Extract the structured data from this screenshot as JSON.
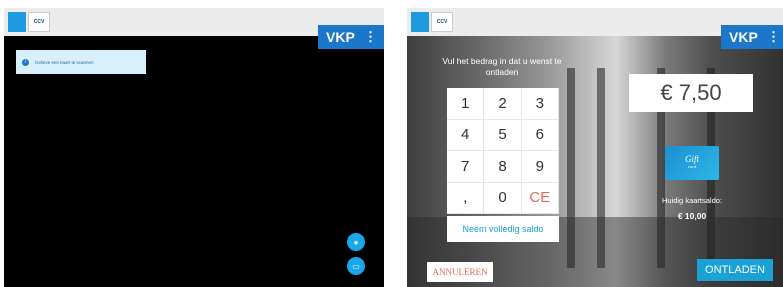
{
  "left_screen": {
    "badge": "VKP",
    "logo_text": "CCV",
    "notice": "Gelieve een kaart te scannen"
  },
  "right_screen": {
    "badge": "VKP",
    "logo_text": "CCV",
    "prompt": "Vul het bedrag in dat u wenst te ontladen",
    "keys": [
      "1",
      "2",
      "3",
      "4",
      "5",
      "6",
      "7",
      "8",
      "9",
      ",",
      "0",
      "CE"
    ],
    "full_balance_button": "Neem volledig saldo",
    "amount": "€ 7,50",
    "giftcard_title": "Gift",
    "giftcard_sub": "card",
    "balance_label": "Huidig kaartsaldo:",
    "balance_value": "€ 10,00",
    "cancel_button": "ANNULEREN",
    "submit_button": "ONTLADEN"
  },
  "colors": {
    "accent": "#1d77c9",
    "button_blue": "#1aa1d6",
    "cancel_red": "#e06a53"
  }
}
